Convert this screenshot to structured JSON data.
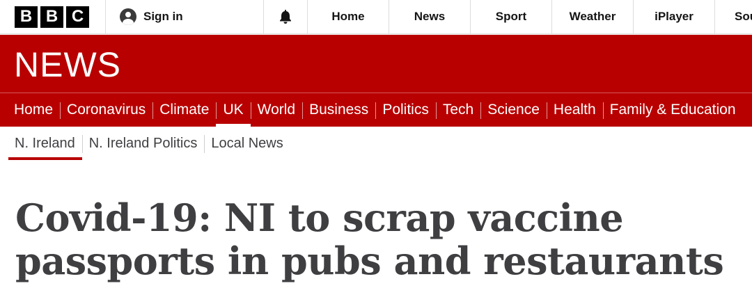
{
  "header": {
    "logo_letters": [
      "B",
      "B",
      "C"
    ],
    "signin_label": "Sign in",
    "bell_icon": "bell-icon",
    "nav": [
      "Home",
      "News",
      "Sport",
      "Weather",
      "iPlayer",
      "Sou"
    ]
  },
  "banner": {
    "title": "NEWS"
  },
  "section_nav": {
    "items": [
      "Home",
      "Coronavirus",
      "Climate",
      "UK",
      "World",
      "Business",
      "Politics",
      "Tech",
      "Science",
      "Health",
      "Family & Education"
    ],
    "active": "UK"
  },
  "sub_nav": {
    "items": [
      "N. Ireland",
      "N. Ireland Politics",
      "Local News"
    ],
    "active": "N. Ireland"
  },
  "article": {
    "headline": "Covid-19: NI to scrap vaccine passports in pubs and restaurants"
  },
  "colors": {
    "brand_red": "#b80000",
    "headline_text": "#3f3f42"
  }
}
